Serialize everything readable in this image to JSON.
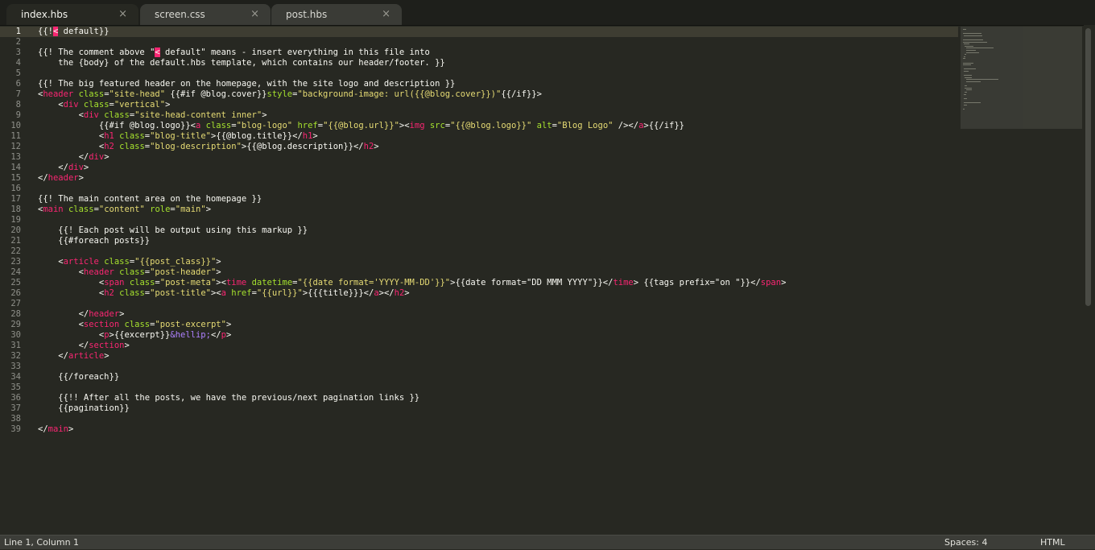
{
  "tabs": [
    {
      "label": "index.hbs",
      "active": true
    },
    {
      "label": "screen.css",
      "active": false
    },
    {
      "label": "post.hbs",
      "active": false
    }
  ],
  "tab_close_glyph": "×",
  "editor": {
    "line_numbers": [
      "1",
      "2",
      "3",
      "4",
      "5",
      "6",
      "7",
      "8",
      "9",
      "10",
      "11",
      "12",
      "13",
      "14",
      "15",
      "16",
      "17",
      "18",
      "19",
      "20",
      "21",
      "22",
      "23",
      "24",
      "25",
      "26",
      "27",
      "28",
      "29",
      "30",
      "31",
      "32",
      "33",
      "34",
      "35",
      "36",
      "37",
      "38",
      "39"
    ],
    "lines": [
      [
        [
          "c",
          "{{!"
        ],
        [
          "hl",
          "<"
        ],
        [
          "c",
          " default}}"
        ]
      ],
      [],
      [
        [
          "c",
          "{{! The comment above \""
        ],
        [
          "hl",
          "<"
        ],
        [
          "c",
          " default\" means - insert everything in this file into"
        ]
      ],
      [
        [
          "c",
          "    the {body} of the default.hbs template, which contains our header/footer. }}"
        ]
      ],
      [],
      [
        [
          "c",
          "{{! The big featured header on the homepage, with the site logo and description }}"
        ]
      ],
      [
        [
          "c",
          "<"
        ],
        [
          "t",
          "header"
        ],
        [
          "c",
          " "
        ],
        [
          "a",
          "class"
        ],
        [
          "c",
          "="
        ],
        [
          "s",
          "\"site-head\""
        ],
        [
          "c",
          " {{#if @blog.cover}}"
        ],
        [
          "a",
          "style"
        ],
        [
          "c",
          "="
        ],
        [
          "s",
          "\"background-image: url({{@blog.cover}})\""
        ],
        [
          "c",
          "{{/if}}>"
        ]
      ],
      [
        [
          "c",
          "    <"
        ],
        [
          "t",
          "div"
        ],
        [
          "c",
          " "
        ],
        [
          "a",
          "class"
        ],
        [
          "c",
          "="
        ],
        [
          "s",
          "\"vertical\""
        ],
        [
          "c",
          ">"
        ]
      ],
      [
        [
          "c",
          "        <"
        ],
        [
          "t",
          "div"
        ],
        [
          "c",
          " "
        ],
        [
          "a",
          "class"
        ],
        [
          "c",
          "="
        ],
        [
          "s",
          "\"site-head-content inner\""
        ],
        [
          "c",
          ">"
        ]
      ],
      [
        [
          "c",
          "            {{#if @blog.logo}}<"
        ],
        [
          "t",
          "a"
        ],
        [
          "c",
          " "
        ],
        [
          "a",
          "class"
        ],
        [
          "c",
          "="
        ],
        [
          "s",
          "\"blog-logo\""
        ],
        [
          "c",
          " "
        ],
        [
          "a",
          "href"
        ],
        [
          "c",
          "="
        ],
        [
          "s",
          "\"{{@blog.url}}\""
        ],
        [
          "c",
          "><"
        ],
        [
          "t",
          "img"
        ],
        [
          "c",
          " "
        ],
        [
          "a",
          "src"
        ],
        [
          "c",
          "="
        ],
        [
          "s",
          "\"{{@blog.logo}}\""
        ],
        [
          "c",
          " "
        ],
        [
          "a",
          "alt"
        ],
        [
          "c",
          "="
        ],
        [
          "s",
          "\"Blog Logo\""
        ],
        [
          "c",
          " /></"
        ],
        [
          "t",
          "a"
        ],
        [
          "c",
          ">{{/if}}"
        ]
      ],
      [
        [
          "c",
          "            <"
        ],
        [
          "t",
          "h1"
        ],
        [
          "c",
          " "
        ],
        [
          "a",
          "class"
        ],
        [
          "c",
          "="
        ],
        [
          "s",
          "\"blog-title\""
        ],
        [
          "c",
          ">{{@blog.title}}</"
        ],
        [
          "t",
          "h1"
        ],
        [
          "c",
          ">"
        ]
      ],
      [
        [
          "c",
          "            <"
        ],
        [
          "t",
          "h2"
        ],
        [
          "c",
          " "
        ],
        [
          "a",
          "class"
        ],
        [
          "c",
          "="
        ],
        [
          "s",
          "\"blog-description\""
        ],
        [
          "c",
          ">{{@blog.description}}</"
        ],
        [
          "t",
          "h2"
        ],
        [
          "c",
          ">"
        ]
      ],
      [
        [
          "c",
          "        </"
        ],
        [
          "t",
          "div"
        ],
        [
          "c",
          ">"
        ]
      ],
      [
        [
          "c",
          "    </"
        ],
        [
          "t",
          "div"
        ],
        [
          "c",
          ">"
        ]
      ],
      [
        [
          "c",
          "</"
        ],
        [
          "t",
          "header"
        ],
        [
          "c",
          ">"
        ]
      ],
      [],
      [
        [
          "c",
          "{{! The main content area on the homepage }}"
        ]
      ],
      [
        [
          "c",
          "<"
        ],
        [
          "t",
          "main"
        ],
        [
          "c",
          " "
        ],
        [
          "a",
          "class"
        ],
        [
          "c",
          "="
        ],
        [
          "s",
          "\"content\""
        ],
        [
          "c",
          " "
        ],
        [
          "a",
          "role"
        ],
        [
          "c",
          "="
        ],
        [
          "s",
          "\"main\""
        ],
        [
          "c",
          ">"
        ]
      ],
      [],
      [
        [
          "c",
          "    {{! Each post will be output using this markup }}"
        ]
      ],
      [
        [
          "c",
          "    {{#foreach posts}}"
        ]
      ],
      [],
      [
        [
          "c",
          "    <"
        ],
        [
          "t",
          "article"
        ],
        [
          "c",
          " "
        ],
        [
          "a",
          "class"
        ],
        [
          "c",
          "="
        ],
        [
          "s",
          "\"{{post_class}}\""
        ],
        [
          "c",
          ">"
        ]
      ],
      [
        [
          "c",
          "        <"
        ],
        [
          "t",
          "header"
        ],
        [
          "c",
          " "
        ],
        [
          "a",
          "class"
        ],
        [
          "c",
          "="
        ],
        [
          "s",
          "\"post-header\""
        ],
        [
          "c",
          ">"
        ]
      ],
      [
        [
          "c",
          "            <"
        ],
        [
          "t",
          "span"
        ],
        [
          "c",
          " "
        ],
        [
          "a",
          "class"
        ],
        [
          "c",
          "="
        ],
        [
          "s",
          "\"post-meta\""
        ],
        [
          "c",
          "><"
        ],
        [
          "t",
          "time"
        ],
        [
          "c",
          " "
        ],
        [
          "a",
          "datetime"
        ],
        [
          "c",
          "="
        ],
        [
          "s",
          "\"{{date format='YYYY-MM-DD'}}\""
        ],
        [
          "c",
          ">{{date format=\"DD MMM YYYY\"}}</"
        ],
        [
          "t",
          "time"
        ],
        [
          "c",
          "> {{tags prefix=\"on \"}}</"
        ],
        [
          "t",
          "span"
        ],
        [
          "c",
          ">"
        ]
      ],
      [
        [
          "c",
          "            <"
        ],
        [
          "t",
          "h2"
        ],
        [
          "c",
          " "
        ],
        [
          "a",
          "class"
        ],
        [
          "c",
          "="
        ],
        [
          "s",
          "\"post-title\""
        ],
        [
          "c",
          "><"
        ],
        [
          "t",
          "a"
        ],
        [
          "c",
          " "
        ],
        [
          "a",
          "href"
        ],
        [
          "c",
          "="
        ],
        [
          "s",
          "\"{{url}}\""
        ],
        [
          "c",
          ">{{{title}}}</"
        ],
        [
          "t",
          "a"
        ],
        [
          "c",
          "></"
        ],
        [
          "t",
          "h2"
        ],
        [
          "c",
          ">"
        ]
      ],
      [],
      [
        [
          "c",
          "        </"
        ],
        [
          "t",
          "header"
        ],
        [
          "c",
          ">"
        ]
      ],
      [
        [
          "c",
          "        <"
        ],
        [
          "t",
          "section"
        ],
        [
          "c",
          " "
        ],
        [
          "a",
          "class"
        ],
        [
          "c",
          "="
        ],
        [
          "s",
          "\"post-excerpt\""
        ],
        [
          "c",
          ">"
        ]
      ],
      [
        [
          "c",
          "            <"
        ],
        [
          "t",
          "p"
        ],
        [
          "c",
          ">{{excerpt}}"
        ],
        [
          "e",
          "&hellip;"
        ],
        [
          "c",
          "</"
        ],
        [
          "t",
          "p"
        ],
        [
          "c",
          ">"
        ]
      ],
      [
        [
          "c",
          "        </"
        ],
        [
          "t",
          "section"
        ],
        [
          "c",
          ">"
        ]
      ],
      [
        [
          "c",
          "    </"
        ],
        [
          "t",
          "article"
        ],
        [
          "c",
          ">"
        ]
      ],
      [],
      [
        [
          "c",
          "    {{/foreach}}"
        ]
      ],
      [],
      [
        [
          "c",
          "    {{!! After all the posts, we have the previous/next pagination links }}"
        ]
      ],
      [
        [
          "c",
          "    {{pagination}}"
        ]
      ],
      [],
      [
        [
          "c",
          "</"
        ],
        [
          "t",
          "main"
        ],
        [
          "c",
          ">"
        ]
      ]
    ]
  },
  "colors": {
    "background": "#272822",
    "tag": "#f92672",
    "attribute": "#a6e22e",
    "string": "#e6db74",
    "entity": "#ae81ff",
    "text": "#f8f8f2"
  },
  "status": {
    "position": "Line 1, Column 1",
    "indentation": "Spaces: 4",
    "syntax": "HTML"
  }
}
